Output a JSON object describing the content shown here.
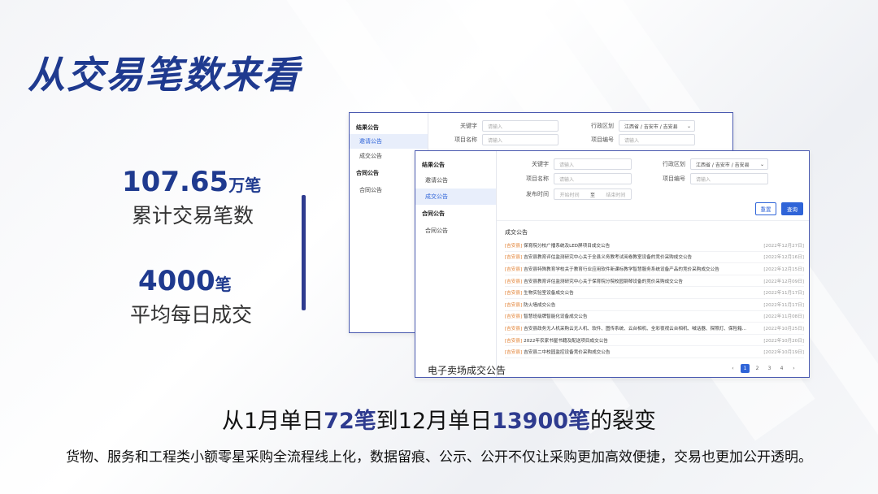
{
  "title": "从交易笔数来看",
  "stats": [
    {
      "value": "107.65",
      "unit": "万笔",
      "label": "累计交易笔数"
    },
    {
      "value": "4000",
      "unit": "笔",
      "label": "平均每日成交"
    }
  ],
  "back_window": {
    "sidebar": {
      "h1": "结果公告",
      "i1": "邀请公告",
      "i2": "成交公告",
      "h2": "合同公告",
      "i3": "合同公告"
    },
    "form": {
      "keyword_label": "关键字",
      "keyword_ph": "请输入",
      "region_label": "行政区划",
      "region_value": "江西省 / 吉安市 / 吉安县",
      "name_label": "项目名称",
      "name_ph": "请输入",
      "no_label": "项目编号",
      "no_ph": "请输入"
    }
  },
  "front_window": {
    "sidebar": {
      "h1": "结果公告",
      "i1": "邀请公告",
      "i2": "成交公告",
      "h2": "合同公告",
      "i3": "合同公告"
    },
    "form": {
      "keyword_label": "关键字",
      "keyword_ph": "请输入",
      "region_label": "行政区划",
      "region_value": "江西省 / 吉安市 / 吉安县",
      "name_label": "项目名称",
      "name_ph": "请输入",
      "no_label": "项目编号",
      "no_ph": "请输入",
      "time_label": "发布时间",
      "start_ph": "开始时间",
      "to": "至",
      "end_ph": "结束时间",
      "reset": "重置",
      "query": "查询"
    },
    "list_title": "成交公告",
    "rows": [
      {
        "tag": "[吉安县]",
        "text": "保育院分校广播系统及LED屏项目成交公告",
        "date": "[2022年12月27日]"
      },
      {
        "tag": "[吉安县]",
        "text": "吉安县教育评估监测研究中心关于全县义务教考试阅卷教室设备的竞价采购成交公告",
        "date": "[2022年12月16日]"
      },
      {
        "tag": "[吉安县]",
        "text": "吉安县特殊教育学校关于教育行业应用软件新课标教学智慧服务系统设备产品的竞价采购成交公告",
        "date": "[2022年12月15日]"
      },
      {
        "tag": "[吉安县]",
        "text": "吉安县教育评估监测研究中心关于保育院分院校园钢琴设备的竞价采购成交公告",
        "date": "[2022年12月09日]"
      },
      {
        "tag": "[吉安县]",
        "text": "生物实验室设备成交公告",
        "date": "[2022年11月17日]"
      },
      {
        "tag": "[吉安县]",
        "text": "防火墙成交公告",
        "date": "[2022年11月17日]"
      },
      {
        "tag": "[吉安县]",
        "text": "智慧班级牌智能化设备成交公告",
        "date": "[2022年11月08日]"
      },
      {
        "tag": "[吉安县]",
        "text": "吉安县政务无人机采购云无人机、软件、图传系统、云台相机、全彩夜视云台相机、喊话器、探照灯、保险箱...",
        "date": "[2022年10月25日]"
      },
      {
        "tag": "[吉安县]",
        "text": "2022年农家书屋书籍及配送项目成交公告",
        "date": "[2022年10月20日]"
      },
      {
        "tag": "[吉安县]",
        "text": "吉安县二中校园监控设备竞价采购成交公告",
        "date": "[2022年10月19日]"
      }
    ],
    "caption": "电子卖场成交公告",
    "pager": {
      "prev": "‹",
      "pages": [
        "1",
        "2",
        "3",
        "4"
      ],
      "next": "›"
    }
  },
  "headline": {
    "p1": "从1月单日",
    "v1": "72笔",
    "p2": "到12月单日",
    "v2": "13900笔",
    "p3": "的裂变"
  },
  "footer": "货物、服务和工程类小额零星采购全流程线上化，数据留痕、公示、公开不仅让采购更加高效便捷，交易也更加公开透明。"
}
